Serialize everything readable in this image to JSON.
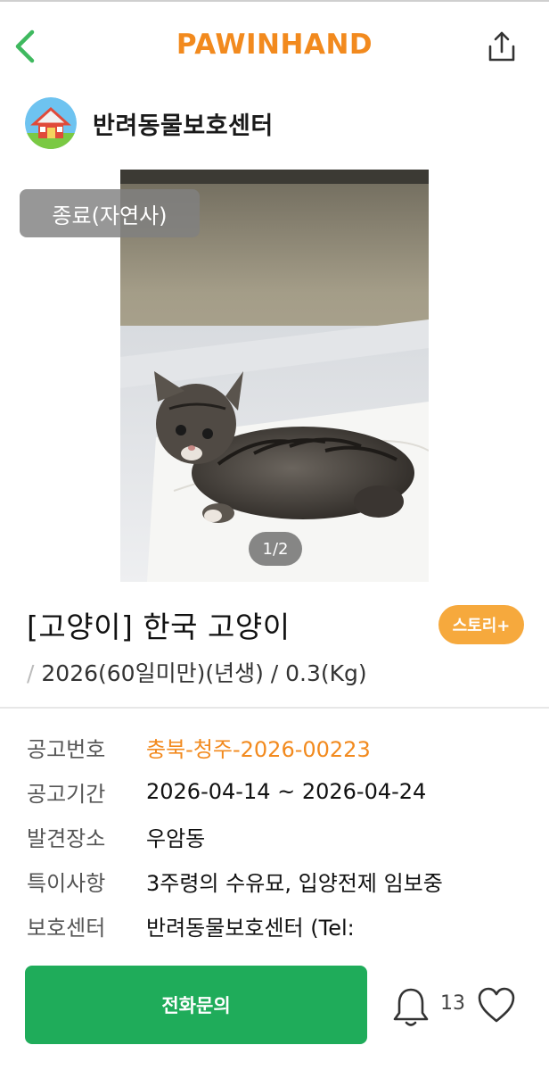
{
  "header": {
    "brand": "PAWINHAND",
    "back_icon": "chevron-left-icon",
    "share_icon": "share-icon",
    "accent_color": "#f28a1e"
  },
  "shelter": {
    "name": "반려동물보호센터",
    "logo_icon": "house-logo-icon"
  },
  "photo": {
    "status_badge": "종료(자연사)",
    "page_indicator": "1/2",
    "current_page": 1,
    "total_pages": 2
  },
  "animal": {
    "title": "[고양이] 한국 고양이",
    "subtitle": "2026(60일미만)(년생) / 0.3(Kg)",
    "story_button": "스토리+"
  },
  "details": [
    {
      "label": "공고번호",
      "value": "충북-청주-2026-00223"
    },
    {
      "label": "공고기간",
      "value": "2026-04-14 ~ 2026-04-24"
    },
    {
      "label": "발견장소",
      "value": "우암동"
    },
    {
      "label": "특이사항",
      "value": "3주령의 수유묘, 입양전제 임보중"
    },
    {
      "label": "보호센터",
      "value": "반려동물보호센터 (Tel:"
    }
  ],
  "actions": {
    "call_button": "전화문의",
    "bell_icon": "bell-icon",
    "bell_count": "13",
    "heart_icon": "heart-icon",
    "call_color": "#1fac5a"
  }
}
